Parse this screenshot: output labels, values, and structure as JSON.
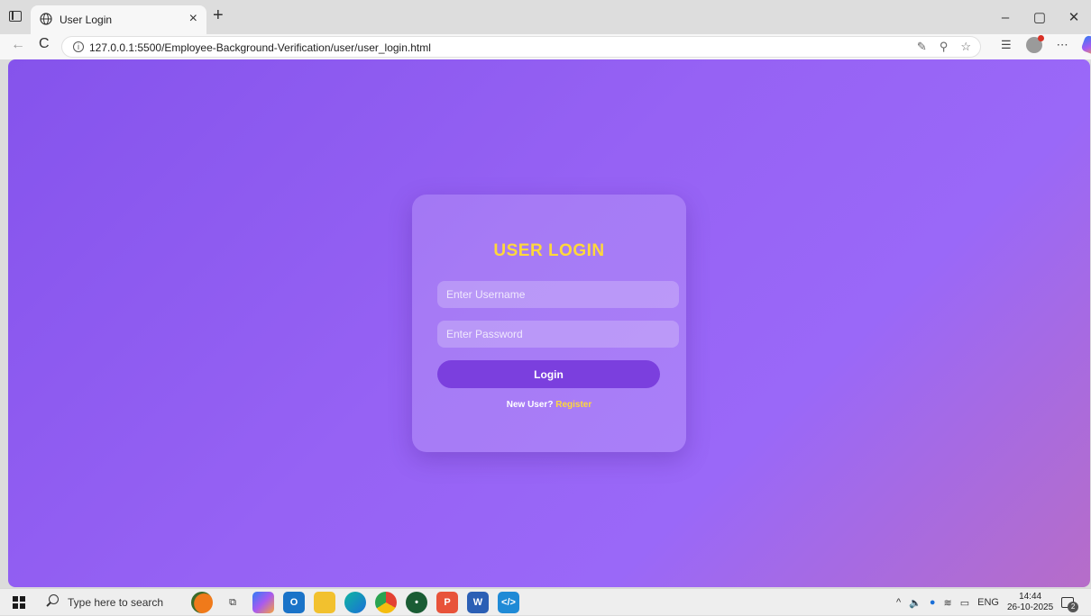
{
  "browser": {
    "tab_title": "User Login",
    "tab_close": "×",
    "new_tab": "+",
    "url": "127.0.0.1:5500/Employee-Background-Verification/user/user_login.html",
    "window_controls": {
      "minimize": "–",
      "maximize": "▢",
      "close": "✕"
    },
    "nav": {
      "back": "←",
      "reload": "C"
    }
  },
  "login": {
    "title": "USER LOGIN",
    "username_placeholder": "Enter Username",
    "password_placeholder": "Enter Password",
    "button_label": "Login",
    "prompt": "New User?",
    "register_label": "Register"
  },
  "taskbar": {
    "search_placeholder": "Type here to search",
    "language": "ENG",
    "time": "14:44",
    "date": "26-10-2025",
    "notification_count": "2"
  },
  "colors": {
    "accent_yellow": "#ffd83b",
    "button_purple": "#7b3fde",
    "background_start": "#8553ec",
    "background_end": "#b66dc8"
  }
}
